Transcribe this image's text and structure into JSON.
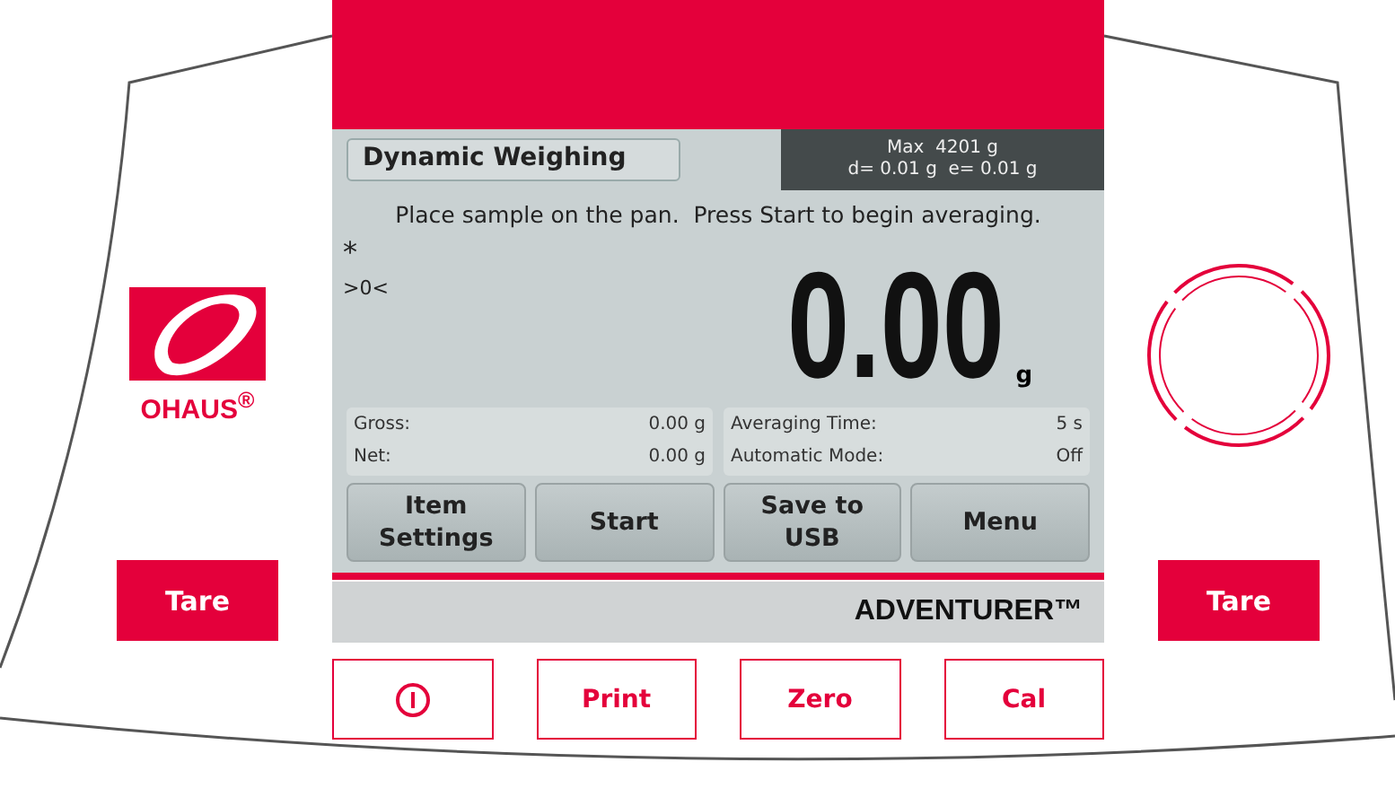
{
  "logo": {
    "brand": "OHAUS$^{®}$"
  },
  "tare_buttons": [
    "Tare",
    "Tare"
  ],
  "screen": {
    "mode_title": "Dynamic Weighing",
    "capacity": "Max  4201 g",
    "readability": "d= 0.01 g  e= 0.01 g",
    "message": "Place sample on the pan.  Press Start to begin averaging.",
    "stable_indicator": "*",
    "zero_indicator": ">0<",
    "weight": "0.00",
    "unit": "g",
    "info_left": [
      {
        "label": "Gross:",
        "value": "0.00 g"
      },
      {
        "label": "Net:",
        "value": "0.00 g"
      }
    ],
    "info_right": [
      {
        "label": "Averaging Time:",
        "value": "5 s"
      },
      {
        "label": "Automatic Mode:",
        "value": "Off"
      }
    ],
    "softkeys": [
      "Item\nSettings",
      "Start",
      "Save to\nUSB",
      "Menu"
    ],
    "model": "ADVENTURER™"
  },
  "keys": [
    {
      "kind": "power"
    },
    {
      "kind": "text",
      "label": "Print"
    },
    {
      "kind": "text",
      "label": "Zero"
    },
    {
      "kind": "text",
      "label": "Cal"
    }
  ]
}
